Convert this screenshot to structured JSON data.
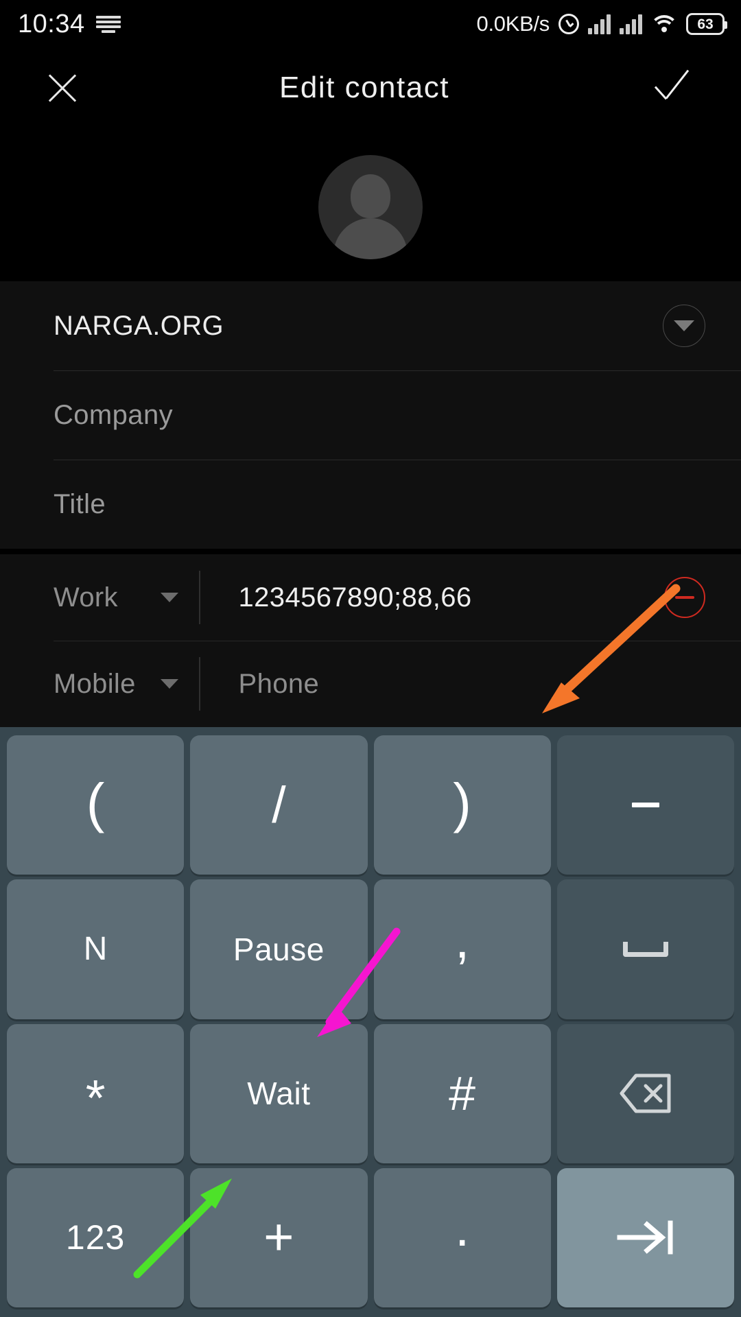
{
  "status_bar": {
    "time": "10:34",
    "keyboard_icon": "keyboard-icon",
    "network_speed": "0.0KB/s",
    "alarm_icon": "alarm-clock-icon",
    "signal_icon_1": "signal-bars-icon",
    "signal_icon_2": "signal-bars-icon",
    "wifi_icon": "wifi-icon",
    "battery_level": "63"
  },
  "app_bar": {
    "close_icon": "close-x-icon",
    "title": "Edit  contact",
    "save_icon": "checkmark-icon"
  },
  "avatar": {
    "icon": "contact-avatar-placeholder"
  },
  "name_section": {
    "name_value": "NARGA.ORG",
    "company_placeholder": "Company",
    "title_placeholder": "Title",
    "expand_icon": "chevron-down-icon"
  },
  "phone_section": {
    "rows": [
      {
        "type_label": "Work",
        "value": "1234567890;88,66",
        "is_placeholder": false,
        "caret_icon": "caret-down-icon",
        "remove_icon": "minus-circle-icon"
      },
      {
        "type_label": "Mobile",
        "value": "Phone",
        "is_placeholder": true,
        "caret_icon": "caret-down-icon"
      }
    ]
  },
  "keyboard": {
    "rows": [
      [
        {
          "label": "(",
          "name": "key-open-paren",
          "style": "paren",
          "kind": "normal"
        },
        {
          "label": "/",
          "name": "key-slash",
          "style": "slash",
          "kind": "normal"
        },
        {
          "label": ")",
          "name": "key-close-paren",
          "style": "paren",
          "kind": "normal"
        },
        {
          "label": "",
          "name": "key-dash",
          "style": "glyph",
          "kind": "fn",
          "glyph": "dash-glyph"
        }
      ],
      [
        {
          "label": "N",
          "name": "key-n",
          "style": "small",
          "kind": "normal"
        },
        {
          "label": "Pause",
          "name": "key-pause",
          "style": "word",
          "kind": "normal"
        },
        {
          "label": ",",
          "name": "key-comma",
          "style": "comma",
          "kind": "normal"
        },
        {
          "label": "",
          "name": "key-space",
          "style": "glyph",
          "kind": "fn",
          "glyph": "space-bar-glyph"
        }
      ],
      [
        {
          "label": "*",
          "name": "key-asterisk",
          "style": "star",
          "kind": "normal"
        },
        {
          "label": "Wait",
          "name": "key-wait",
          "style": "word",
          "kind": "normal"
        },
        {
          "label": "#",
          "name": "key-hash",
          "style": "hash",
          "kind": "normal"
        },
        {
          "label": "",
          "name": "key-backspace",
          "style": "glyph",
          "kind": "fn",
          "glyph": "backspace-icon"
        }
      ],
      [
        {
          "label": "123",
          "name": "key-numeric-mode",
          "style": "num",
          "kind": "normal"
        },
        {
          "label": "+",
          "name": "key-plus",
          "style": "plus",
          "kind": "normal"
        },
        {
          "label": ".",
          "name": "key-period",
          "style": "dot",
          "kind": "normal"
        },
        {
          "label": "",
          "name": "key-next-field",
          "style": "glyph",
          "kind": "action",
          "glyph": "next-field-icon"
        }
      ]
    ]
  },
  "annotations": [
    {
      "name": "orange-arrow-pointing-to-phone-number",
      "color": "#F4762A"
    },
    {
      "name": "magenta-arrow-pointing-to-pause-key",
      "color": "#F515D0"
    },
    {
      "name": "green-arrow-pointing-to-wait-key",
      "color": "#4DE229"
    }
  ]
}
